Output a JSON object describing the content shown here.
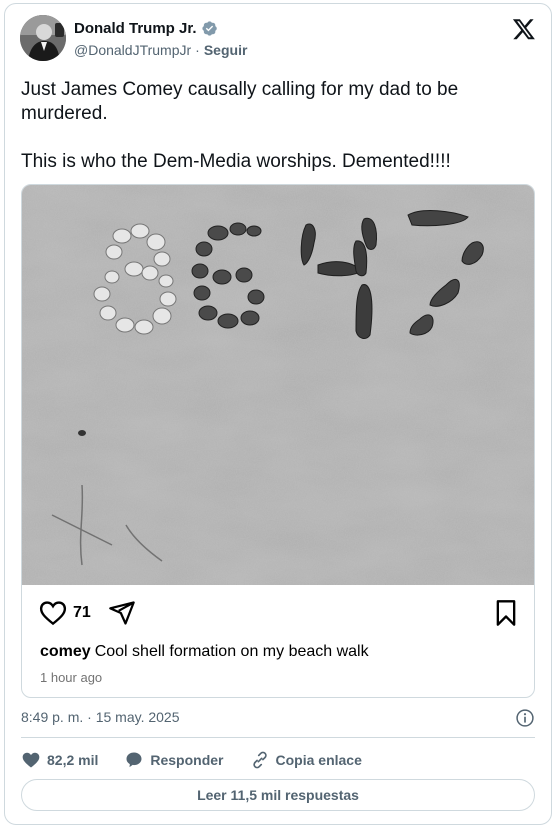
{
  "author": {
    "display_name": "Donald Trump Jr.",
    "handle": "@DonaldJTrumpJr",
    "separator": "·",
    "follow_label": "Seguir",
    "verified_color": "#829aab"
  },
  "tweet": {
    "lines": [
      "Just James Comey causally calling for my dad to be murdered.",
      "This is who the Dem-Media worships. Demented!!!!"
    ],
    "timestamp": "8:49 p. m. · 15 may. 2025"
  },
  "embed": {
    "photo_text": "8647",
    "likes": "71",
    "username": "comey",
    "caption": "Cool shell formation on my beach walk",
    "time_ago": "1 hour ago"
  },
  "actions": {
    "like_count": "82,2 mil",
    "reply_label": "Responder",
    "copy_label": "Copia enlace",
    "read_replies_label": "Leer 11,5 mil respuestas"
  },
  "colors": {
    "text": "#0f1419",
    "muted": "#536471",
    "border": "#cfd9de"
  }
}
